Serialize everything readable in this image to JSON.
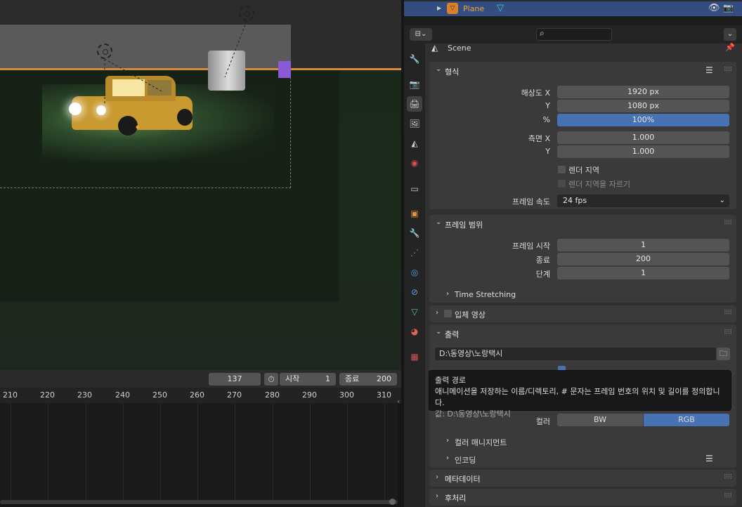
{
  "outliner": {
    "object_name": "Plane"
  },
  "viewport": {},
  "timeline": {
    "current_frame": "137",
    "start_label": "시작",
    "start_value": "1",
    "end_label": "종료",
    "end_value": "200",
    "ticks": [
      "210",
      "220",
      "230",
      "240",
      "250",
      "260",
      "270",
      "280",
      "290",
      "300",
      "310"
    ]
  },
  "properties": {
    "context": "Scene",
    "format": {
      "title": "형식",
      "res_x_label": "해상도 X",
      "res_x": "1920 px",
      "res_y_label": "Y",
      "res_y": "1080 px",
      "percent_label": "%",
      "percent": "100%",
      "aspect_x_label": "측면 X",
      "aspect_x": "1.000",
      "aspect_y_label": "Y",
      "aspect_y": "1.000",
      "render_region": "렌더 지역",
      "crop_region": "렌더 지역을 자르기",
      "fps_label": "프레임 속도",
      "fps": "24 fps"
    },
    "frame_range": {
      "title": "프레임 범위",
      "start_label": "프레임 시작",
      "start": "1",
      "end_label": "종료",
      "end": "200",
      "step_label": "단계",
      "step": "1",
      "time_stretching": "Time Stretching"
    },
    "stereoscopy": {
      "title": "입체 영상"
    },
    "output": {
      "title": "출력",
      "path": "D:\\동영상\\노랑택시",
      "color_label": "컬러",
      "bw": "BW",
      "rgb": "RGB",
      "color_management": "컬러 매니지먼트",
      "encoding": "인코딩"
    },
    "metadata": {
      "title": "메타데이터"
    },
    "post_processing": {
      "title": "후처리"
    }
  },
  "tooltip": {
    "title": "출력 경로",
    "description": "애니메이션을 저장하는 이름/디렉토리, # 문자는 프레임 번호의 위치 및 길이를 정의합니다.",
    "value": "값: D:\\동영상\\노랑택시"
  },
  "colors": {
    "accent_blue": "#4772b3",
    "selection_blue": "#334d80",
    "horizon_orange": "#d8893a"
  }
}
